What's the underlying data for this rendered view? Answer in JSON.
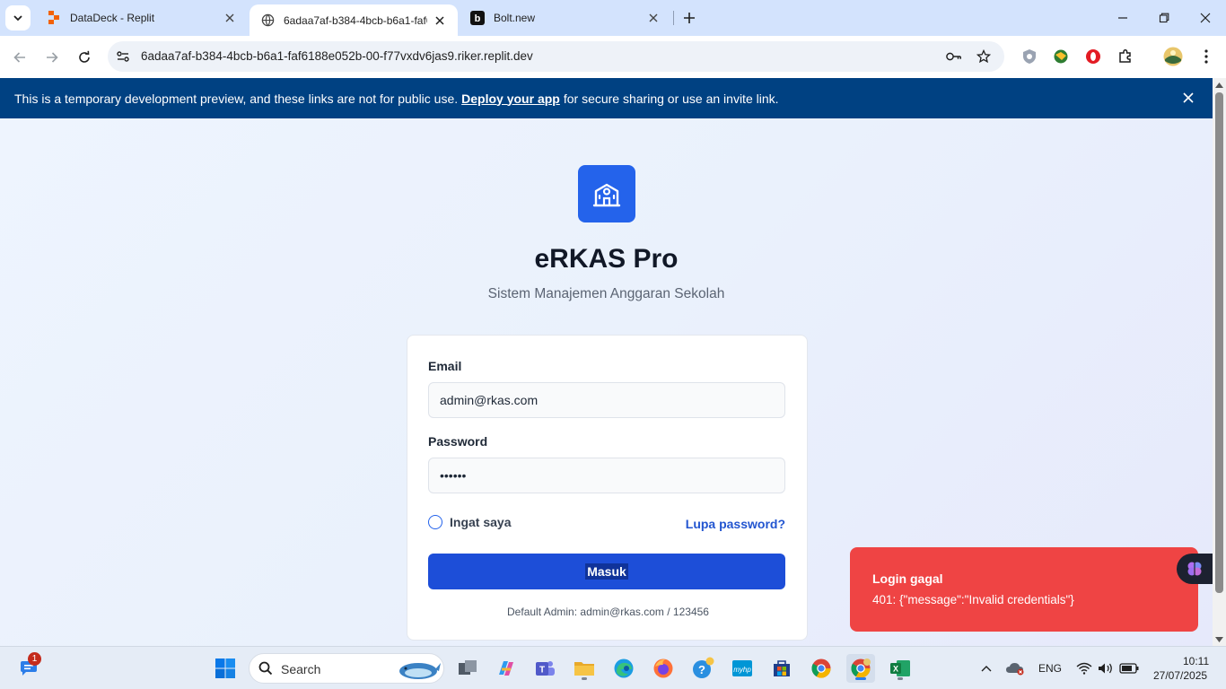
{
  "browser": {
    "tabs": [
      {
        "label": "DataDeck - Replit",
        "active": false
      },
      {
        "label": "6adaa7af-b384-4bcb-b6a1-faf6",
        "active": true
      },
      {
        "label": "Bolt.new",
        "active": false
      }
    ],
    "url": "6adaa7af-b384-4bcb-b6a1-faf6188e052b-00-f77vxdv6jas9.riker.replit.dev"
  },
  "banner": {
    "text_before": "This is a temporary development preview, and these links are not for public use.",
    "link": "Deploy your app",
    "text_after": "for secure sharing or use an invite link."
  },
  "app": {
    "title": "eRKAS Pro",
    "subtitle": "Sistem Manajemen Anggaran Sekolah"
  },
  "form": {
    "email_label": "Email",
    "email_value": "admin@rkas.com",
    "password_label": "Password",
    "password_value": "••••••",
    "remember_label": "Ingat saya",
    "forgot_label": "Lupa password?",
    "submit_label": "Masuk",
    "default_hint": "Default Admin: admin@rkas.com / 123456"
  },
  "toast": {
    "title": "Login gagal",
    "message": "401: {\"message\":\"Invalid credentials\"}"
  },
  "taskbar": {
    "search_placeholder": "Search",
    "chat_badge": "1",
    "language": "ENG",
    "time": "10:11",
    "date": "27/07/2025"
  },
  "colors": {
    "primary": "#2463eb",
    "submit": "#1d4ed8",
    "banner": "#004182",
    "toast": "#ef4444"
  }
}
